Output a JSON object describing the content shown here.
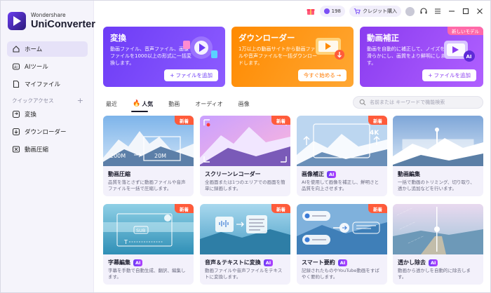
{
  "brand": {
    "sub": "Wondershare",
    "name": "UniConverter"
  },
  "sidebar": {
    "items": [
      {
        "label": "ホーム",
        "icon": "home-icon"
      },
      {
        "label": "AIツール",
        "icon": "ai-icon"
      },
      {
        "label": "マイファイル",
        "icon": "file-icon"
      }
    ],
    "quick_access_label": "クイックアクセス",
    "quick_items": [
      {
        "label": "変換",
        "icon": "convert-icon"
      },
      {
        "label": "ダウンローダー",
        "icon": "download-icon"
      },
      {
        "label": "動画圧縮",
        "icon": "compress-icon"
      }
    ]
  },
  "titlebar": {
    "credits": "198",
    "buy_label": "クレジット購入"
  },
  "banners": [
    {
      "title": "変換",
      "desc": "動画ファイル、音声ファイル、画像ファイルを1000以上の形式に一括変換します。",
      "button": "ファイルを追加",
      "button_prefix": "+"
    },
    {
      "title": "ダウンローダー",
      "desc": "1万以上の動画サイトから動画ファイルや音声ファイルを一括ダウンロードします。",
      "button": "今すぐ始める",
      "button_suffix": "→"
    },
    {
      "title": "動画補正",
      "desc": "動画を自動的に補正して、ノイズを滑らかにし、画質をより鮮明にします。",
      "button": "ファイルを追加",
      "button_prefix": "+",
      "badge": "新しいモデル"
    }
  ],
  "tabs": [
    {
      "label": "最近"
    },
    {
      "label": "人気",
      "icon": "fire-icon"
    },
    {
      "label": "動画"
    },
    {
      "label": "オーディオ"
    },
    {
      "label": "画像"
    }
  ],
  "search": {
    "placeholder": "名前または キーワードで機能検索"
  },
  "cards": [
    {
      "title": "動画圧縮",
      "desc": "品質を落とさずに動画ファイルや音声ファイルを一括で圧縮します。",
      "badge": "新着",
      "ai": false
    },
    {
      "title": "スクリーンレコーダー",
      "desc": "全画面または1つのエリアでの画面を簡単に録画します。",
      "badge": "新着",
      "ai": false
    },
    {
      "title": "画像補正",
      "desc": "AIを使用して画像を補正し、鮮明さと品質を向上させます。",
      "badge": "新着",
      "ai": true,
      "ai_label": "AI"
    },
    {
      "title": "動画編集",
      "desc": "一括で動画のトリミング、切り取り、透かし追加などを行います。",
      "badge": "",
      "ai": false
    },
    {
      "title": "字幕編集",
      "desc": "字幕を手動で自動生成、翻訳、編集します。",
      "badge": "新着",
      "ai": true,
      "ai_label": "AI"
    },
    {
      "title": "音声＆テキストに変換",
      "desc": "動画ファイルや音声ファイルをテキストに変換します。",
      "badge": "新着",
      "ai": true,
      "ai_label": "AI"
    },
    {
      "title": "スマート要約",
      "desc": "記録されたものやYouTube動画をすばやく要約します。",
      "badge": "新着",
      "ai": true,
      "ai_label": "AI"
    },
    {
      "title": "透かし除去",
      "desc": "動画から透かしを自動的に除去します。",
      "badge": "",
      "ai": true,
      "ai_label": "AI"
    }
  ],
  "card_thumb_texts": {
    "compress_from": "200M",
    "compress_to": "20M",
    "upscale_label": "4K",
    "subtitle_tag": "SUB",
    "subtitle_cursor": "T"
  },
  "colors": {
    "accent": "#6d3cf6",
    "orange": "#ff8a00",
    "new_badge": "#ff5b3a"
  }
}
